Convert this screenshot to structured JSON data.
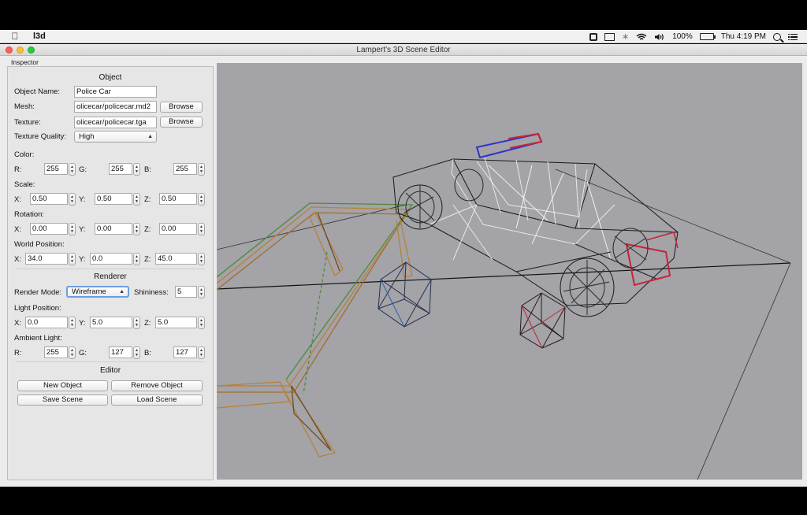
{
  "menubar": {
    "app_name": "l3d",
    "battery_percent": "100%",
    "clock": "Thu 4:19 PM",
    "icons": [
      "apple-icon",
      "dropbox-icon",
      "display-icon",
      "bluetooth-icon",
      "wifi-icon",
      "volume-icon",
      "battery-icon",
      "spotlight-icon",
      "notification-list-icon"
    ]
  },
  "window": {
    "title": "Lampert's 3D Scene Editor"
  },
  "inspector": {
    "tab_label": "Inspector",
    "object_section": "Object",
    "object_name_label": "Object Name:",
    "object_name_value": "Police Car",
    "mesh_label": "Mesh:",
    "mesh_value": "olicecar/policecar.md2",
    "texture_label": "Texture:",
    "texture_value": "olicecar/policecar.tga",
    "browse_label": "Browse",
    "texture_quality_label": "Texture Quality:",
    "texture_quality_value": "High",
    "color_label": "Color:",
    "color": {
      "r_label": "R:",
      "r": "255",
      "g_label": "G:",
      "g": "255",
      "b_label": "B:",
      "b": "255"
    },
    "scale_label": "Scale:",
    "scale": {
      "x_label": "X:",
      "x": "0.50",
      "y_label": "Y:",
      "y": "0.50",
      "z_label": "Z:",
      "z": "0.50"
    },
    "rotation_label": "Rotation:",
    "rotation": {
      "x_label": "X:",
      "x": "0.00",
      "y_label": "Y:",
      "y": "0.00",
      "z_label": "Z:",
      "z": "0.00"
    },
    "world_position_label": "World Position:",
    "world_position": {
      "x_label": "X:",
      "x": "34.0",
      "y_label": "Y:",
      "y": "0.0",
      "z_label": "Z:",
      "z": "45.0"
    },
    "renderer_section": "Renderer",
    "render_mode_label": "Render Mode:",
    "render_mode_value": "Wireframe",
    "shininess_label": "Shininess:",
    "shininess_value": "5",
    "light_position_label": "Light Position:",
    "light_position": {
      "x_label": "X:",
      "x": "0.0",
      "y_label": "Y:",
      "y": "5.0",
      "z_label": "Z:",
      "z": "5.0"
    },
    "ambient_light_label": "Ambient Light:",
    "ambient_light": {
      "r_label": "R:",
      "r": "255",
      "g_label": "G:",
      "g": "127",
      "b_label": "B:",
      "b": "127"
    },
    "editor_section": "Editor",
    "new_object_label": "New Object",
    "remove_object_label": "Remove Object",
    "save_scene_label": "Save Scene",
    "load_scene_label": "Load Scene"
  },
  "viewport": {
    "background_color": "#a3a3a8",
    "render_mode": "wireframe",
    "objects": [
      "police-car",
      "table",
      "blue-cube",
      "red-cube",
      "floor-grid"
    ]
  }
}
